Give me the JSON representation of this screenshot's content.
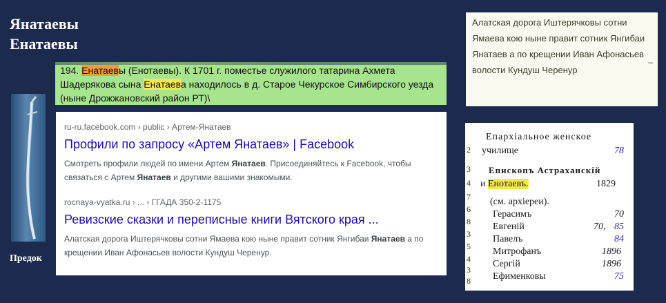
{
  "heading": {
    "line1": "Янатаевы",
    "line2": "Енатаевы"
  },
  "portrait": {
    "caption": "Предок"
  },
  "green_excerpt": {
    "part1": "194. ",
    "highlight1": "Енатаев",
    "part2": "ы (Енотаевы). К 1701 г. поместье служилого татарина Ахмета Шадерякова сына ",
    "highlight2": "Енатаев",
    "part3": "а находилось в д. Старое Чекурское Симбирского уезда (ныне Дрожжановский район РТ)\\"
  },
  "results": [
    {
      "url": "ru-ru.facebook.com › public › Артем-Янатаев",
      "title": "Профили по запросу «Артем Янатаев» | Facebook",
      "snippet_a": "Смотреть профили людей по имени Артем ",
      "snippet_b1": "Янатаев",
      "snippet_c": ". Присоединяйтесь к Facebook, чтобы связаться с Артем ",
      "snippet_b2": "Янатаев",
      "snippet_d": " и другими вашими знакомыми."
    },
    {
      "url": "rocnaya-vyatka.ru › ... › ГГАДА 350-2-1175",
      "title": "Ревизские сказки и переписные книги Вятского края ...",
      "snippet_a": "Алатская дорога Иштерячковы сотни Ямаева кою ныне правит сотник Янгибаи ",
      "snippet_b1": "Янатаев",
      "snippet_c": " а по крещении Иван Афонасьев волости Кундуш Черенур.",
      "snippet_b2": "",
      "snippet_d": ""
    }
  ],
  "note": {
    "text": "Алатская дорога Иштерячковы сотни Ямаева кою ныне правит сотник Янгибаи Янатаев а по крещении Иван Афонасьев волости Кундуш Черенур",
    "mark": "–"
  },
  "index": {
    "rows": [
      {
        "name": "Епархіальное женское",
        "num": ""
      },
      {
        "name": "училище",
        "num": "78"
      },
      {
        "name": "Епископъ Астраханскій",
        "num": ""
      },
      {
        "name": "Енотаевъ.",
        "num": "1829",
        "pre": "и ",
        "highlight": true
      },
      {
        "name": "(см. архіереи).",
        "num": ""
      },
      {
        "name": "Герасимъ",
        "num": "70"
      },
      {
        "name": "Евгеній",
        "num": "85",
        "mid": "70, "
      },
      {
        "name": "Павелъ",
        "num": "84"
      },
      {
        "name": "Митрофанъ",
        "num": "1896"
      },
      {
        "name": "Сергій",
        "num": "1896"
      },
      {
        "name": "Ефименковы",
        "num": "75"
      }
    ],
    "margin_marks": [
      "2",
      "3",
      "4",
      "7",
      "6",
      "8",
      "3",
      "5",
      "4",
      "3",
      "8"
    ]
  }
}
